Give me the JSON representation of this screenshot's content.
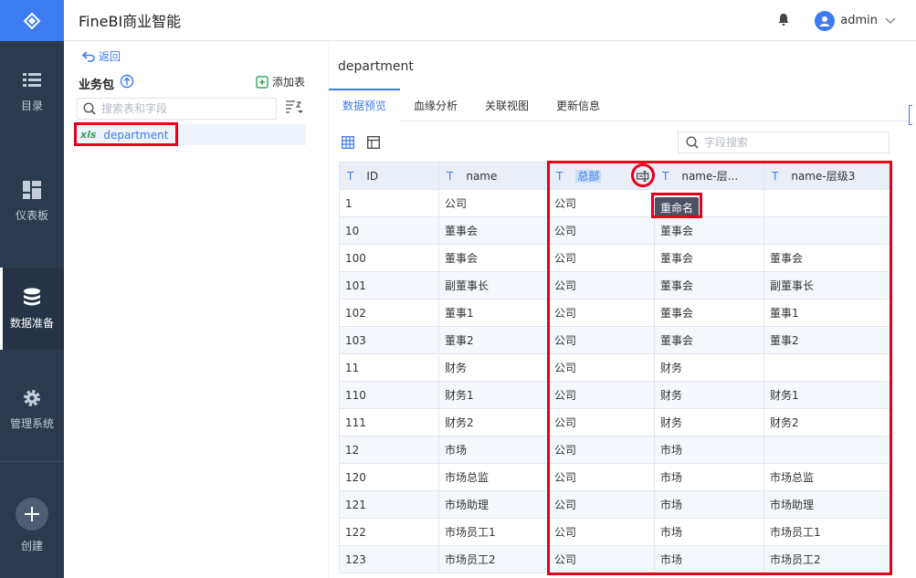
{
  "header": {
    "title": "FineBI商业智能",
    "user": "admin"
  },
  "nav": {
    "items": [
      {
        "label": "目录",
        "icon": "list-icon"
      },
      {
        "label": "仪表板",
        "icon": "dashboard-icon"
      },
      {
        "label": "数据准备",
        "icon": "database-icon",
        "active": true
      },
      {
        "label": "管理系统",
        "icon": "gear-icon"
      }
    ],
    "create_label": "创建"
  },
  "package": {
    "back_label": "返回",
    "title": "业务包",
    "add_table_label": "添加表",
    "search_placeholder": "搜索表和字段",
    "tables": [
      {
        "type": "xls",
        "name": "department"
      }
    ]
  },
  "main": {
    "table_name": "department",
    "tabs": [
      {
        "label": "数据预览",
        "active": true
      },
      {
        "label": "血缘分析"
      },
      {
        "label": "关联视图"
      },
      {
        "label": "更新信息"
      }
    ],
    "field_search_placeholder": "字段搜索",
    "tooltip": "重命名",
    "columns": [
      {
        "type": "T",
        "name": "ID"
      },
      {
        "type": "T",
        "name": "name"
      },
      {
        "type": "T",
        "name": "总部"
      },
      {
        "type": "T",
        "name": "name-层..."
      },
      {
        "type": "T",
        "name": "name-层级3"
      }
    ],
    "rows": [
      [
        "1",
        "公司",
        "公司",
        "",
        ""
      ],
      [
        "10",
        "董事会",
        "公司",
        "董事会",
        ""
      ],
      [
        "100",
        "董事会",
        "公司",
        "董事会",
        "董事会"
      ],
      [
        "101",
        "副董事长",
        "公司",
        "董事会",
        "副董事长"
      ],
      [
        "102",
        "董事1",
        "公司",
        "董事会",
        "董事1"
      ],
      [
        "103",
        "董事2",
        "公司",
        "董事会",
        "董事2"
      ],
      [
        "11",
        "财务",
        "公司",
        "财务",
        ""
      ],
      [
        "110",
        "财务1",
        "公司",
        "财务",
        "财务1"
      ],
      [
        "111",
        "财务2",
        "公司",
        "财务",
        "财务2"
      ],
      [
        "12",
        "市场",
        "公司",
        "市场",
        ""
      ],
      [
        "120",
        "市场总监",
        "公司",
        "市场",
        "市场总监"
      ],
      [
        "121",
        "市场助理",
        "公司",
        "市场",
        "市场助理"
      ],
      [
        "122",
        "市场员工1",
        "公司",
        "市场",
        "市场员工1"
      ],
      [
        "123",
        "市场员工2",
        "公司",
        "市场",
        "市场员工2"
      ]
    ]
  },
  "colors": {
    "accent": "#3d7bf0",
    "nav_bg": "#2b3a4f",
    "highlight": "#e6001a"
  }
}
